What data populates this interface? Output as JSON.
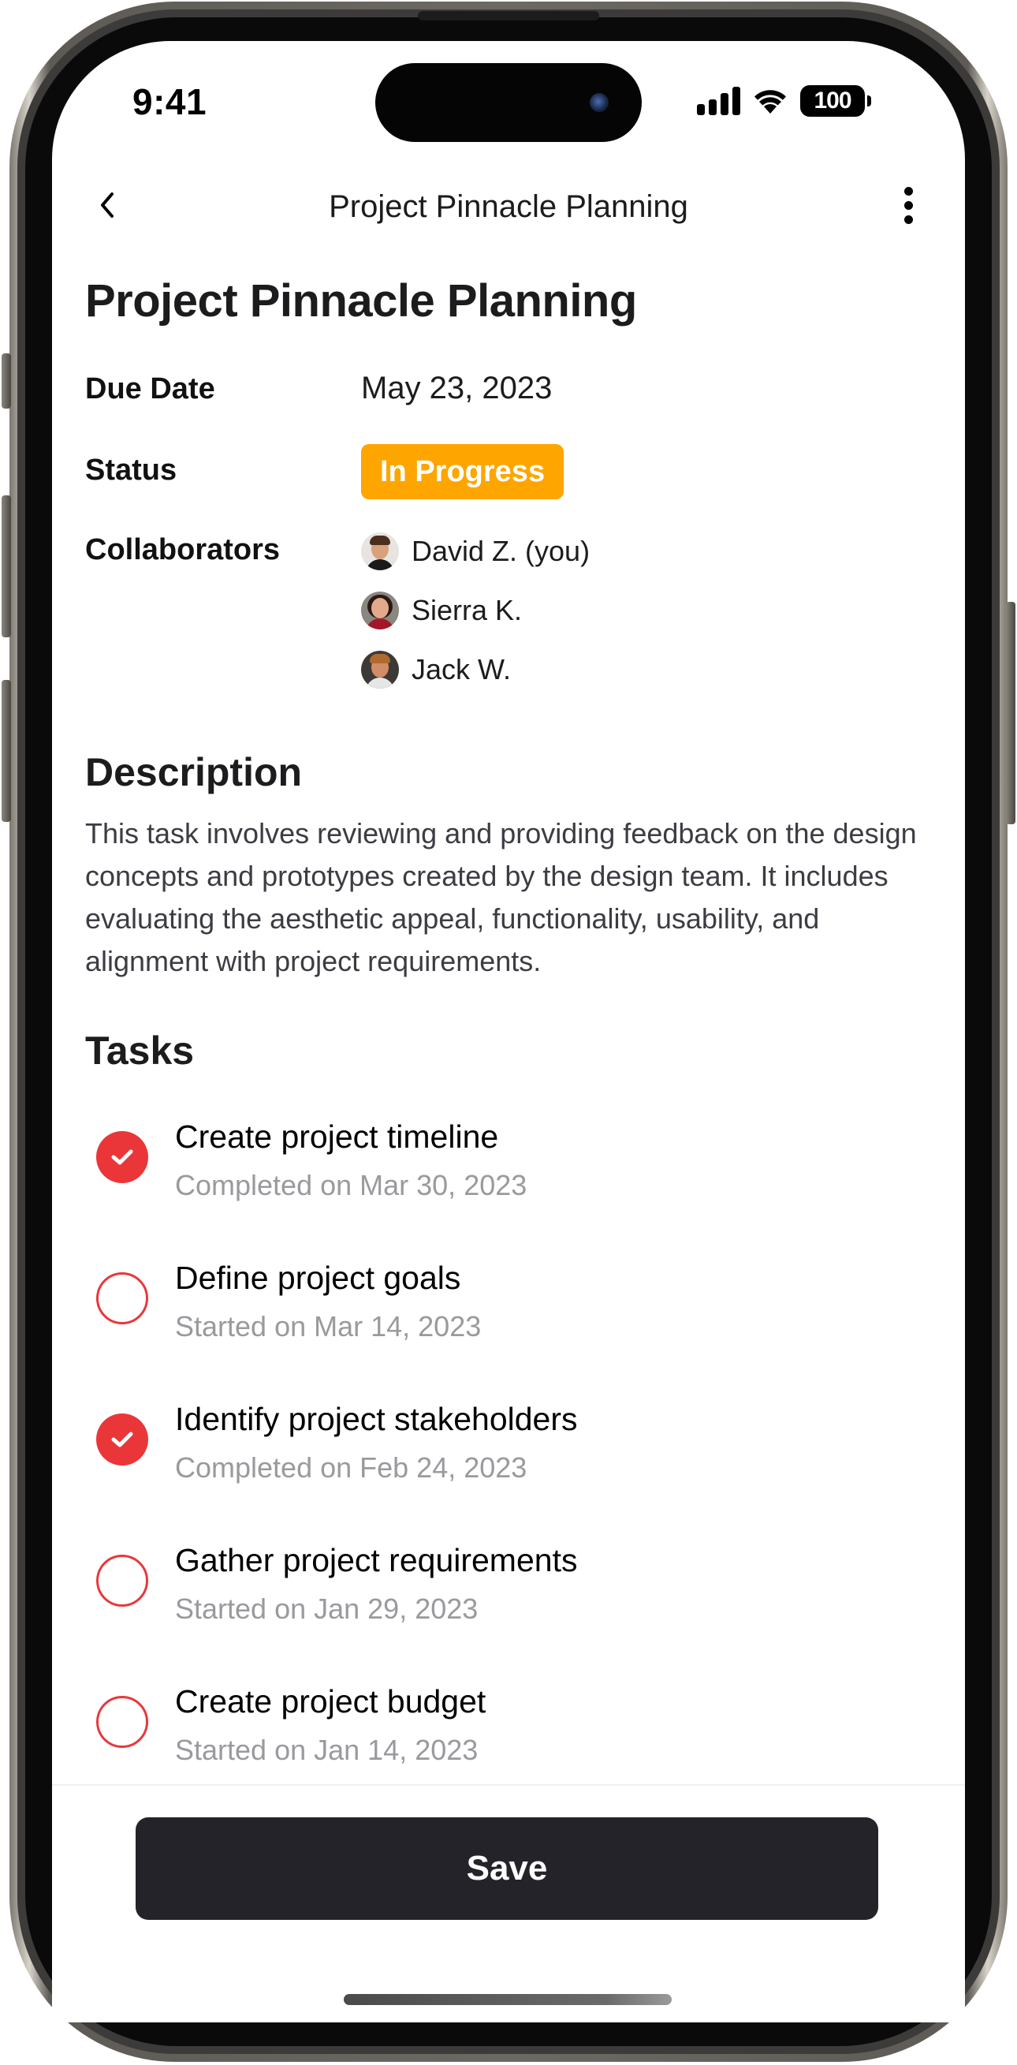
{
  "status_bar": {
    "time": "9:41",
    "battery": "100",
    "icons": [
      "signal-icon",
      "wifi-icon",
      "battery-icon"
    ]
  },
  "nav": {
    "title": "Project Pinnacle Planning",
    "back_icon": "chevron-left-icon",
    "more_icon": "more-vertical-icon"
  },
  "project": {
    "title": "Project Pinnacle Planning",
    "due_date_label": "Due Date",
    "due_date": "May 23, 2023",
    "status_label": "Status",
    "status": "In Progress",
    "status_color": "#FFA500",
    "collaborators_label": "Collaborators",
    "collaborators": [
      {
        "name": "David Z. (you)"
      },
      {
        "name": "Sierra K."
      },
      {
        "name": "Jack W."
      }
    ]
  },
  "description": {
    "heading": "Description",
    "text": "This task involves reviewing and providing feedback on the design concepts and prototypes created by the design team. It includes evaluating the aesthetic appeal, functionality, usability, and alignment with project requirements."
  },
  "tasks": {
    "heading": "Tasks",
    "accent_color": "#EA3638",
    "items": [
      {
        "title": "Create project timeline",
        "subtitle": "Completed on Mar 30, 2023",
        "completed": true
      },
      {
        "title": "Define project goals",
        "subtitle": "Started on Mar 14, 2023",
        "completed": false
      },
      {
        "title": "Identify project stakeholders",
        "subtitle": "Completed on Feb 24, 2023",
        "completed": true
      },
      {
        "title": "Gather project requirements",
        "subtitle": "Started on Jan 29, 2023",
        "completed": false
      },
      {
        "title": "Create project budget",
        "subtitle": "Started on Jan 14, 2023",
        "completed": false
      }
    ]
  },
  "footer": {
    "save_label": "Save"
  }
}
